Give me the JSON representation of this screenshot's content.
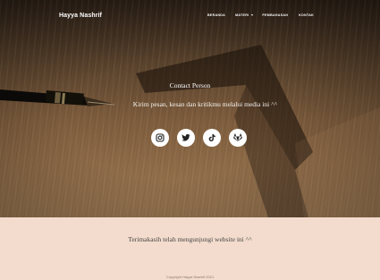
{
  "nav": {
    "brand": "Hayya Nashrif",
    "links": [
      "BERANDA",
      "MATERI",
      "PEMBAHASAN",
      "KONTAK"
    ]
  },
  "contact": {
    "title": "Contact Person",
    "subtitle": "Kirim pesan, kesan dan kritikmu melalui media ini ^^",
    "social_icons": [
      "instagram-icon",
      "twitter-icon",
      "tiktok-icon",
      "gitlab-icon"
    ]
  },
  "footer": {
    "thanks": "Terimakasih telah mengunjungi website ini ^^",
    "copyright": "Copyright Hayya Nashrif 2021"
  },
  "colors": {
    "footer_bg": "#f3dccd",
    "hero_text": "#ffffff",
    "icon_fg": "#222222"
  }
}
